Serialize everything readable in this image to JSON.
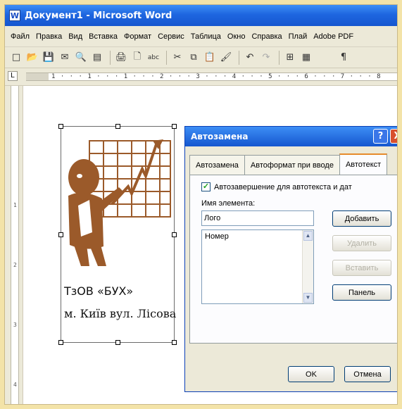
{
  "window": {
    "title": "Документ1 - Microsoft Word",
    "app_icon": "W"
  },
  "menu": [
    "Файл",
    "Правка",
    "Вид",
    "Вставка",
    "Формат",
    "Сервис",
    "Таблица",
    "Окно",
    "Справка",
    "Плай",
    "Adobe PDF"
  ],
  "toolbar": {
    "icons": [
      "new-icon",
      "open-icon",
      "save-icon",
      "permission-icon",
      "search-icon",
      "research-icon",
      "print-icon",
      "preview-icon",
      "spelling-icon",
      "cut-icon",
      "copy-icon",
      "paste-icon",
      "format-painter-icon",
      "undo-icon",
      "redo-icon",
      "table-icon",
      "doc-map-icon",
      "show-hide-icon"
    ],
    "glyphs": [
      "□",
      "📂",
      "💾",
      "✉",
      "🔍",
      "▤",
      "🖨",
      "🗋",
      "abc",
      "✂",
      "⧉",
      "📋",
      "🖌",
      "↶",
      "↷",
      "⊞",
      "▦",
      "¶"
    ]
  },
  "ruler": {
    "tab_box": "L",
    "marks": "1 · · · 1 · · · 1 · · · 2 · · · 3 · · · 4 · · · 5 · · · 6 · · · 7 · · · 8",
    "vertical_marks": [
      "1",
      "2",
      "3",
      "4"
    ]
  },
  "document": {
    "logo_line1": "ТзОВ «БУХ»",
    "logo_line2": "м. Київ вул. Лісова",
    "logo_color": "#9b5a2a"
  },
  "dialog": {
    "title": "Автозамена",
    "help_label": "?",
    "close_label": "X",
    "tabs": [
      "Автозамена",
      "Автоформат при вводе",
      "Автотекст"
    ],
    "active_tab": "Автотекст",
    "checkbox_label": "Автозавершение для автотекста и дат",
    "checkbox_checked": true,
    "name_label": "Имя элемента:",
    "name_value": "Лого",
    "list_items": [
      "Номер"
    ],
    "buttons": {
      "add": "Добавить",
      "delete": "Удалить",
      "insert": "Вставить",
      "panel": "Панель",
      "ok": "OK",
      "cancel": "Отмена"
    }
  }
}
